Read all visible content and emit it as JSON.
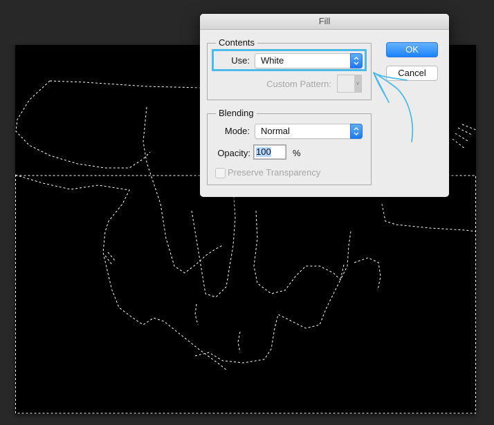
{
  "dialog": {
    "title": "Fill",
    "contents": {
      "group_label": "Contents",
      "use_label": "Use:",
      "use_value": "White",
      "custom_pattern_label": "Custom Pattern:"
    },
    "blending": {
      "group_label": "Blending",
      "mode_label": "Mode:",
      "mode_value": "Normal",
      "opacity_label": "Opacity:",
      "opacity_value": "100",
      "opacity_unit": "%",
      "preserve_transparency_label": "Preserve Transparency",
      "preserve_transparency_checked": false
    },
    "buttons": {
      "ok": "OK",
      "cancel": "Cancel"
    }
  },
  "colors": {
    "accent_blue": "#1a82fb",
    "annotation_highlight": "#4cbbe9",
    "canvas_background": "#000000",
    "workspace_background": "#282828"
  }
}
